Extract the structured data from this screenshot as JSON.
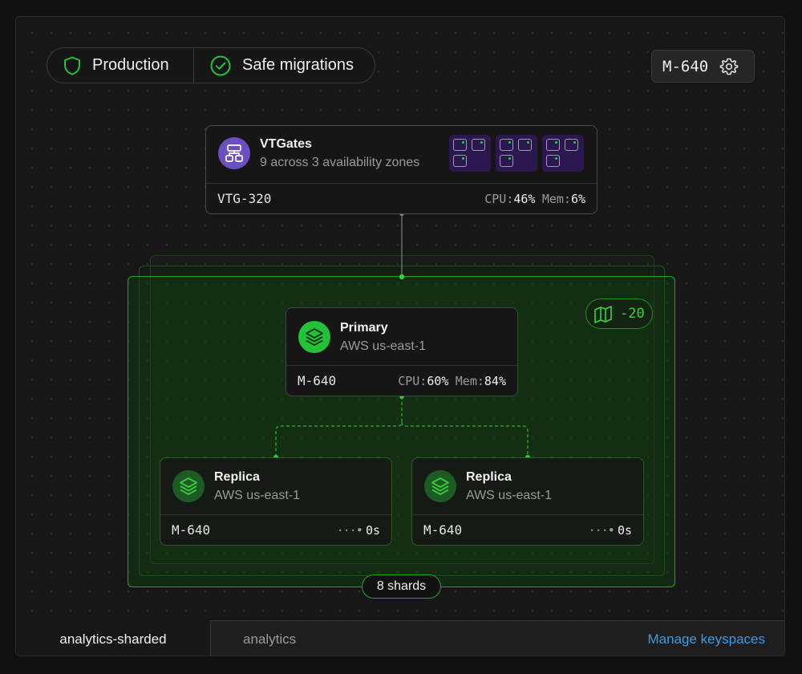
{
  "environment": {
    "production_label": "Production",
    "safe_migrations_label": "Safe migrations"
  },
  "branch_button": {
    "label": "M-640"
  },
  "vtgates": {
    "title": "VTGates",
    "subtitle": "9 across 3 availability zones",
    "id": "VTG-320",
    "cpu_label": "CPU:",
    "cpu_value": "46%",
    "mem_label": "Mem:",
    "mem_value": "6%"
  },
  "shard_group": {
    "delta_label": "-20",
    "shards_label": "8 shards"
  },
  "primary": {
    "title": "Primary",
    "subtitle": "AWS us-east-1",
    "id": "M-640",
    "cpu_label": "CPU:",
    "cpu_value": "60%",
    "mem_label": "Mem:",
    "mem_value": "84%"
  },
  "replicas": [
    {
      "title": "Replica",
      "subtitle": "AWS us-east-1",
      "id": "M-640",
      "lag": "0s"
    },
    {
      "title": "Replica",
      "subtitle": "AWS us-east-1",
      "id": "M-640",
      "lag": "0s"
    }
  ],
  "tabs": {
    "active": "analytics-sharded",
    "other": "analytics",
    "manage_link": "Manage keyspaces"
  },
  "colors": {
    "accent_green": "#22c33a",
    "vtgate_purple": "#6a4fc0",
    "link_blue": "#3b9be8"
  }
}
